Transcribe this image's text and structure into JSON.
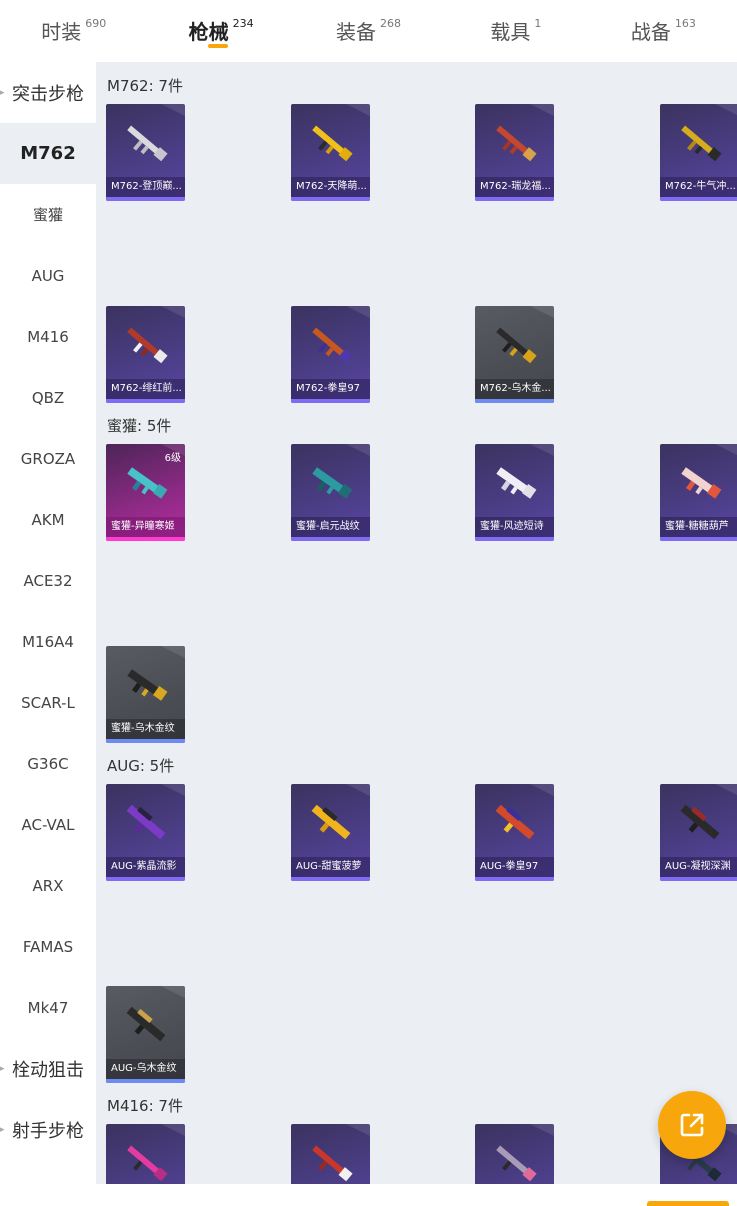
{
  "tabs": [
    {
      "label": "时装",
      "count": "690"
    },
    {
      "label": "枪械",
      "count": "234"
    },
    {
      "label": "装备",
      "count": "268"
    },
    {
      "label": "载具",
      "count": "1"
    },
    {
      "label": "战备",
      "count": "163"
    }
  ],
  "sidebar": {
    "items": [
      {
        "label": "突击步枪"
      },
      {
        "label": "M762"
      },
      {
        "label": "蜜獾"
      },
      {
        "label": "AUG"
      },
      {
        "label": "M416"
      },
      {
        "label": "QBZ"
      },
      {
        "label": "GROZA"
      },
      {
        "label": "AKM"
      },
      {
        "label": "ACE32"
      },
      {
        "label": "M16A4"
      },
      {
        "label": "SCAR-L"
      },
      {
        "label": "G36C"
      },
      {
        "label": "AC-VAL"
      },
      {
        "label": "ARX"
      },
      {
        "label": "FAMAS"
      },
      {
        "label": "Mk47"
      },
      {
        "label": "栓动狙击"
      },
      {
        "label": "射手步枪"
      }
    ]
  },
  "sections": [
    {
      "title": "M762: 7件",
      "items": [
        {
          "label": "M762-登顶巅..."
        },
        {
          "label": "M762-天降萌..."
        },
        {
          "label": "M762-瑞龙福..."
        },
        {
          "label": "M762-牛气冲..."
        },
        {
          "label": "M762-绯红前..."
        },
        {
          "label": "M762-拳皇97"
        },
        {
          "label": "M762-乌木金..."
        }
      ]
    },
    {
      "title": "蜜獾: 5件",
      "items": [
        {
          "label": "蜜獾-异瞳寒姬",
          "badge": "6级"
        },
        {
          "label": "蜜獾-启元战纹"
        },
        {
          "label": "蜜獾-风迹短诗"
        },
        {
          "label": "蜜獾-糖糖葫芦"
        },
        {
          "label": "蜜獾-乌木金纹"
        }
      ]
    },
    {
      "title": "AUG: 5件",
      "items": [
        {
          "label": "AUG-紫晶流影"
        },
        {
          "label": "AUG-甜蜜菠萝"
        },
        {
          "label": "AUG-拳皇97"
        },
        {
          "label": "AUG-凝视深渊"
        },
        {
          "label": "AUG-乌木金纹"
        }
      ]
    },
    {
      "title": "M416: 7件"
    }
  ],
  "colors": {
    "accent": "#f7a70b",
    "content_bg": "#ebeef2",
    "rarity_purple_bar": "#7f6cf3",
    "rarity_pink_bar": "#ff3bd0"
  },
  "icons": {
    "fab": "share-external-icon"
  }
}
